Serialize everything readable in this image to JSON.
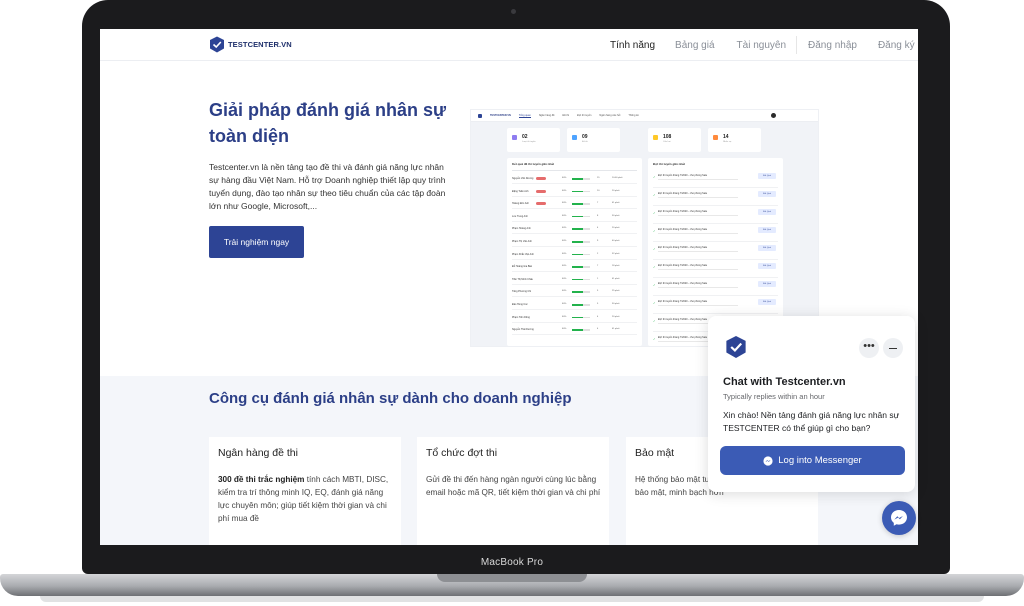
{
  "nav": {
    "brand": "TESTCENTER.VN",
    "items": [
      "Tính năng",
      "Bảng giá",
      "Tài nguyên"
    ],
    "login": "Đăng nhập",
    "signup": "Đăng ký"
  },
  "hero": {
    "title_line1": "Giải pháp đánh giá nhân sự",
    "title_line2": "toàn diện",
    "description": "Testcenter.vn là nền tảng tạo đề thi và đánh giá năng lực nhân sự hàng đầu Việt Nam. Hỗ trợ Doanh nghiệp thiết lập quy trình tuyển dụng, đào tạo nhân sự theo tiêu chuẩn của các tập đoàn lớn như Google, Microsoft,...",
    "cta": "Trải nghiệm ngay"
  },
  "dashboard": {
    "brand": "TESTCENTER.VN",
    "nav": [
      "Tổng quan",
      "Ngân hàng đề",
      "Đề thi",
      "Đợt thi tuyển",
      "Ngân hàng câu hỏi",
      "Thống kê"
    ],
    "stats": [
      {
        "num": "02",
        "label": "Lượt thi tuyển",
        "color": "#8e7cf0"
      },
      {
        "num": "09",
        "label": "Đề thi",
        "color": "#4ea3ff"
      },
      {
        "num": "108",
        "label": "Câu hỏi",
        "color": "#ffc828"
      },
      {
        "num": "14",
        "label": "Nhân sự",
        "color": "#ff8a3c"
      }
    ],
    "left_title": "Kết quả đề thi tuyển gần nhất",
    "right_title": "Đợt thi tuyển gần nhất",
    "rows": [
      {
        "name": "Nguyễn Văn Dương",
        "pct": "60%",
        "fill": 0.6,
        "n": "15",
        "t": "10:00 phút",
        "tag": true
      },
      {
        "name": "Đặng Tuấn Anh",
        "pct": "60%",
        "fill": 0.6,
        "n": "10",
        "t": "20 phút",
        "tag": true
      },
      {
        "name": "Hoàng Đức Anh",
        "pct": "60%",
        "fill": 0.6,
        "n": "7",
        "t": "41 phút",
        "tag": true
      },
      {
        "name": "Lưu Trung Anh",
        "pct": "60%",
        "fill": 0.6,
        "n": "8",
        "t": "30 phút",
        "tag": false
      },
      {
        "name": "Phạm Hoàng Anh",
        "pct": "60%",
        "fill": 0.6,
        "n": "4",
        "t": "20 phút",
        "tag": false
      },
      {
        "name": "Phạm Thị Vân Anh",
        "pct": "60%",
        "fill": 0.6,
        "n": "9",
        "t": "40 phút",
        "tag": false
      },
      {
        "name": "Phạm Khắc Việt Anh",
        "pct": "60%",
        "fill": 0.6,
        "n": "2",
        "t": "32 phút",
        "tag": false
      },
      {
        "name": "Đỗ Hoàng Gia Bảo",
        "pct": "60%",
        "fill": 0.6,
        "n": "7",
        "t": "18 phút",
        "tag": false
      },
      {
        "name": "Trần Thị Minh Châu",
        "pct": "60%",
        "fill": 0.6,
        "n": "1",
        "t": "41 phút",
        "tag": false
      },
      {
        "name": "Tăng Phương Chi",
        "pct": "60%",
        "fill": 0.6,
        "n": "5",
        "t": "25 phút",
        "tag": false
      },
      {
        "name": "Đào Hùng Cúc",
        "pct": "60%",
        "fill": 0.6,
        "n": "5",
        "t": "30 phút",
        "tag": false
      },
      {
        "name": "Phạm Tiến Dũng",
        "pct": "60%",
        "fill": 0.6,
        "n": "4",
        "t": "20 phút",
        "tag": false
      },
      {
        "name": "Nguyễn Thái Dương",
        "pct": "60%",
        "fill": 0.6,
        "n": "4",
        "t": "41 phút",
        "tag": false
      }
    ],
    "drives": [
      "Đợt thi tuyển tháng 7/2020 - cho phòng Sale",
      "Đợt thi tuyển tháng 7/2020 - cho phòng Sale",
      "Đợt thi tuyển tháng 7/2020 - cho phòng Sale",
      "Đợt thi tuyển tháng 7/2020 - cho phòng Sale",
      "Đợt thi tuyển tháng 7/2020 - cho phòng Sale",
      "Đợt thi tuyển tháng 7/2020 - cho phòng Sale",
      "Đợt thi tuyển tháng 7/2020 - cho phòng Sale",
      "Đợt thi tuyển tháng 7/2020 - cho phòng Sale",
      "Đợt thi tuyển tháng 7/2020 - cho phòng Sale",
      "Đợt thi tuyển tháng 7/2020 - cho phòng Sale"
    ],
    "drive_btn": "Kết Quả"
  },
  "features": {
    "title": "Công cụ đánh giá nhân sự dành cho doanh nghiệp",
    "cards": [
      {
        "title": "Ngân hàng đề thi",
        "bold": "300 đề thi trắc nghiệm",
        "text": " tính cách MBTI, DISC, kiểm tra trí thông minh IQ, EQ, đánh giá năng lực chuyên môn; giúp tiết kiệm thời gian và chi phí mua đề"
      },
      {
        "title": "Tổ chức đợt thi",
        "bold": "",
        "text": "Gửi đề thi đến hàng ngàn người cùng lúc bằng email hoặc mã QR, tiết kiệm thời gian và chi phí"
      },
      {
        "title": "Bảo mật",
        "bold": "",
        "text": "Hệ thống bảo mật tuyệt đối, giúp kỳ thi diễn ra bảo mật, minh bạch hơn"
      }
    ]
  },
  "chat": {
    "title": "Chat with Testcenter.vn",
    "subtitle": "Typically replies within an hour",
    "message": "Xin chào! Nền tảng đánh giá năng lực nhân sự TESTCENTER có thể giúp gì cho bạn?",
    "button": "Log into Messenger",
    "more": "•••"
  },
  "laptop": {
    "model": "MacBook Pro"
  },
  "colors": {
    "brand": "#2d4495",
    "heading": "#2c3f87",
    "messenger": "#3b5bb5",
    "success": "#22b24c"
  }
}
